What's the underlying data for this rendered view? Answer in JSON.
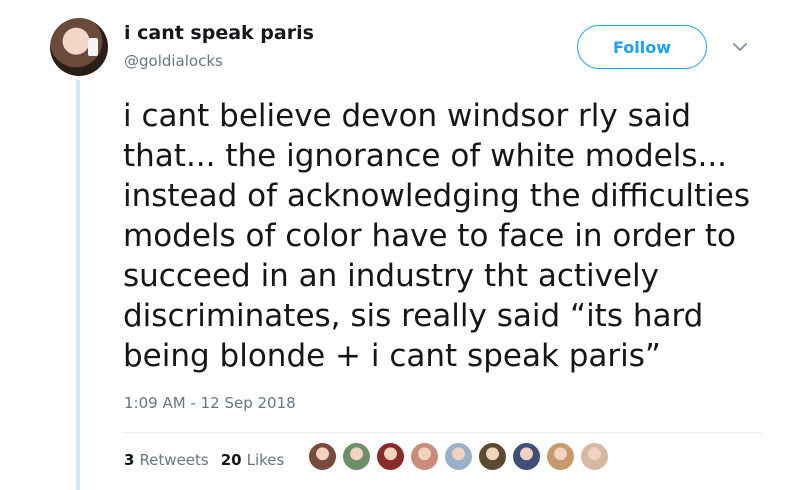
{
  "user": {
    "display_name": "i cant speak paris",
    "handle": "@goldialocks"
  },
  "follow_button": {
    "label": "Follow"
  },
  "tweet": {
    "text": "i cant believe devon windsor rly said\nthat... the ignorance of white models...\ninstead of acknowledging the difficulties\nmodels of color have to face in order to\nsucceed in an industry tht actively\ndiscriminates, sis really said “its hard\nbeing blonde + i cant speak paris”",
    "timestamp": "1:09 AM - 12 Sep 2018"
  },
  "stats": {
    "retweets_count": "3",
    "retweets_label": "Retweets",
    "likes_count": "20",
    "likes_label": "Likes"
  },
  "likers": [
    {
      "color": "#7a4a3c"
    },
    {
      "color": "#6d8f6a"
    },
    {
      "color": "#8a2b2b"
    },
    {
      "color": "#c98b7a"
    },
    {
      "color": "#9ab0c8"
    },
    {
      "color": "#5a4a2f"
    },
    {
      "color": "#3f4f7a"
    },
    {
      "color": "#c69a6a"
    },
    {
      "color": "#d7b8a3"
    }
  ]
}
